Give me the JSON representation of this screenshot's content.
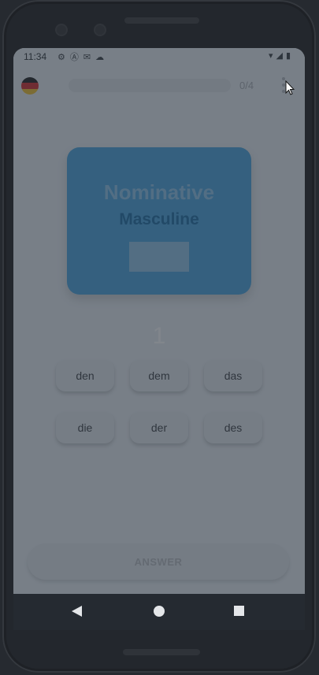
{
  "status_bar": {
    "time": "11:34",
    "left_icons": [
      "gear-icon",
      "a-badge-icon",
      "mail-icon",
      "cloud-icon"
    ],
    "right_icons": [
      "wifi-icon",
      "signal-icon",
      "battery-icon"
    ]
  },
  "header": {
    "flag": "germany-flag",
    "progress_text": "0/4",
    "progress_value": 0
  },
  "card": {
    "case_label": "Nominative",
    "gender_label": "Masculine",
    "card_color": "#4aa4df"
  },
  "countdown": "1",
  "choices": [
    {
      "label": "den"
    },
    {
      "label": "dem"
    },
    {
      "label": "das"
    },
    {
      "label": "die"
    },
    {
      "label": "der"
    },
    {
      "label": "des"
    }
  ],
  "answer_button": {
    "label": "ANSWER"
  },
  "navigation": {
    "items": [
      "back-icon",
      "home-icon",
      "recents-icon"
    ]
  }
}
